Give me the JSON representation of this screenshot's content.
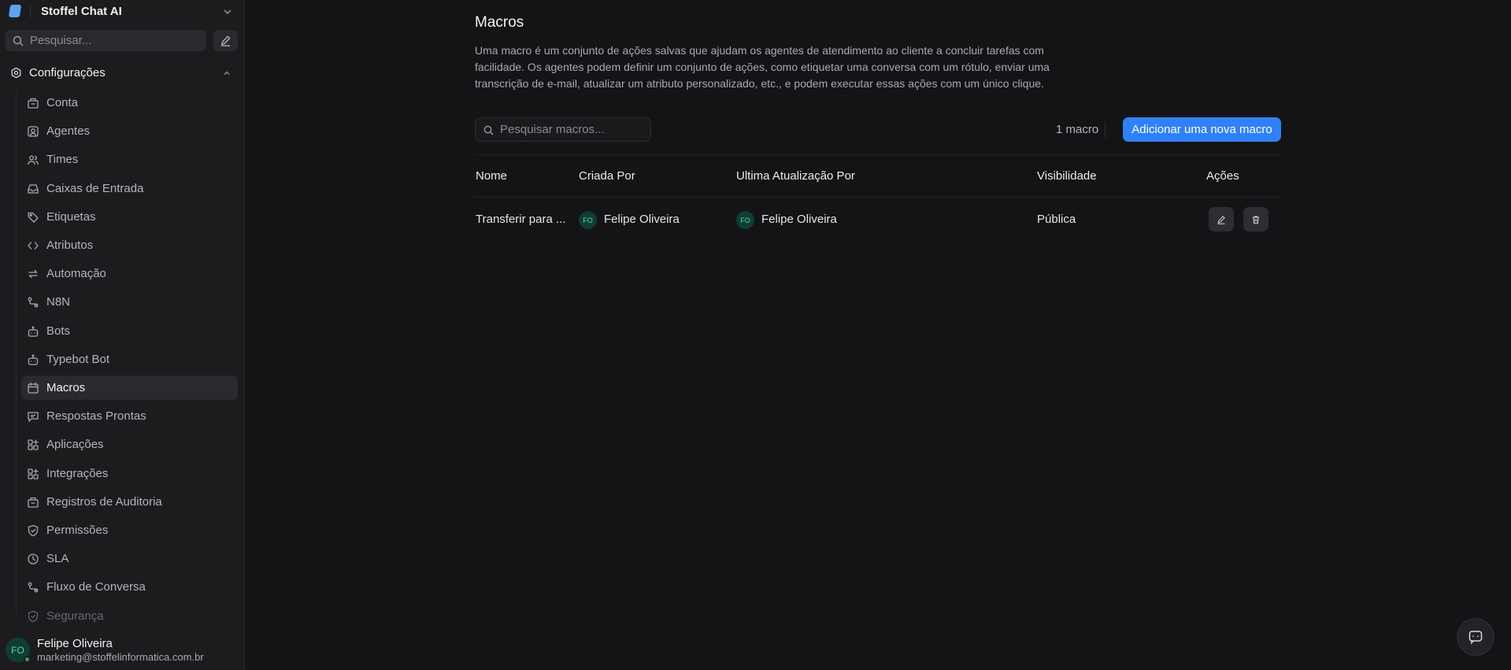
{
  "brand": {
    "name": "Stoffel Chat AI"
  },
  "sidebar": {
    "search_placeholder": "Pesquisar...",
    "section_label": "Configurações",
    "items": [
      {
        "label": "Conta",
        "icon": "building-icon"
      },
      {
        "label": "Agentes",
        "icon": "user-square-icon"
      },
      {
        "label": "Times",
        "icon": "users-icon"
      },
      {
        "label": "Caixas de Entrada",
        "icon": "inbox-icon"
      },
      {
        "label": "Etiquetas",
        "icon": "tag-icon"
      },
      {
        "label": "Atributos",
        "icon": "code-icon"
      },
      {
        "label": "Automação",
        "icon": "arrows-repeat-icon"
      },
      {
        "label": "N8N",
        "icon": "flow-icon"
      },
      {
        "label": "Bots",
        "icon": "bot-icon"
      },
      {
        "label": "Typebot Bot",
        "icon": "bot-icon"
      },
      {
        "label": "Macros",
        "icon": "calendar-icon"
      },
      {
        "label": "Respostas Prontas",
        "icon": "message-square-icon"
      },
      {
        "label": "Aplicações",
        "icon": "grid-plus-icon"
      },
      {
        "label": "Integrações",
        "icon": "grid-plus-icon"
      },
      {
        "label": "Registros de Auditoria",
        "icon": "building-icon"
      },
      {
        "label": "Permissões",
        "icon": "shield-icon"
      },
      {
        "label": "SLA",
        "icon": "clock-icon"
      },
      {
        "label": "Fluxo de Conversa",
        "icon": "flow-icon"
      },
      {
        "label": "Segurança",
        "icon": "shield-icon"
      }
    ],
    "active_item": "Macros"
  },
  "user": {
    "initials": "FO",
    "name": "Felipe Oliveira",
    "email": "marketing@stoffelinformatica.com.br"
  },
  "main": {
    "title": "Macros",
    "description": "Uma macro é um conjunto de ações salvas que ajudam os agentes de atendimento ao cliente a concluir tarefas com facilidade. Os agentes podem definir um conjunto de ações, como etiquetar uma conversa com um rótulo, enviar uma transcrição de e-mail, atualizar um atributo personalizado, etc., e podem executar essas ações com um único clique.",
    "search_placeholder": "Pesquisar macros...",
    "count_label": "1 macro",
    "add_button": "Adicionar uma nova macro",
    "table": {
      "headers": [
        "Nome",
        "Criada Por",
        "Ultima Atualização Por",
        "Visibilidade",
        "Ações"
      ],
      "rows": [
        {
          "name": "Transferir para ...",
          "created_by": {
            "initials": "FO",
            "name": "Felipe Oliveira"
          },
          "updated_by": {
            "initials": "FO",
            "name": "Felipe Oliveira"
          },
          "visibility": "Pública"
        }
      ]
    }
  },
  "colors": {
    "accent": "#2f81f7",
    "background": "#141416",
    "sidebar": "#1c1c1f"
  }
}
